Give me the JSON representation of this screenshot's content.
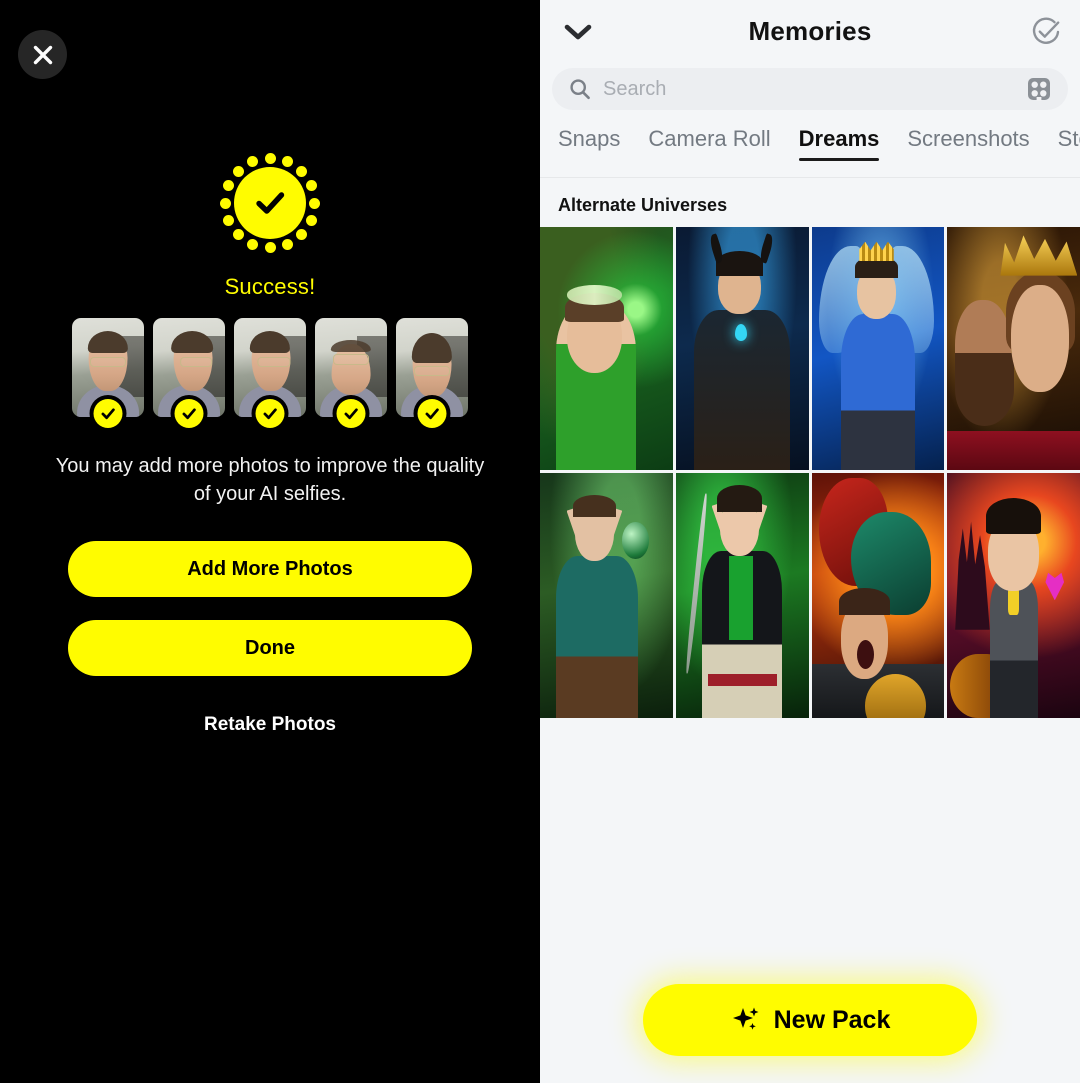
{
  "left": {
    "close_icon": "close-icon",
    "status_icon": "success-check-icon",
    "status_label": "Success!",
    "photos": [
      {
        "label": "selfie-front",
        "verified": true
      },
      {
        "label": "selfie-left-profile",
        "verified": true
      },
      {
        "label": "selfie-right-profile",
        "verified": true
      },
      {
        "label": "selfie-looking-up",
        "verified": true
      },
      {
        "label": "selfie-looking-down",
        "verified": true
      }
    ],
    "helper_text": "You may add more photos to improve the quality of your AI selfies.",
    "primary_button": "Add More Photos",
    "secondary_button": "Done",
    "text_button": "Retake Photos",
    "accent_color": "#FFFC00",
    "background_color": "#000000"
  },
  "right": {
    "header": {
      "collapse_icon": "chevron-down-icon",
      "title": "Memories",
      "select_icon": "circle-check-icon"
    },
    "search": {
      "icon": "search-icon",
      "placeholder": "Search",
      "value": "",
      "layout_icon": "grid-layout-icon"
    },
    "tabs": [
      {
        "label": "Snaps",
        "active": false
      },
      {
        "label": "Camera Roll",
        "active": false
      },
      {
        "label": "Dreams",
        "active": true
      },
      {
        "label": "Screenshots",
        "active": false
      },
      {
        "label": "Stories",
        "active": false
      }
    ],
    "section_title": "Alternate Universes",
    "gallery": [
      {
        "name": "green-forest-elf-king",
        "alt": "Smiling man in green shirt with leafy crown and star necklace"
      },
      {
        "name": "dark-horned-warrior",
        "alt": "Armored warrior with horns and glowing blue gem"
      },
      {
        "name": "blue-winged-fairy-king",
        "alt": "Man with translucent wings, gold crown and blue bodysuit"
      },
      {
        "name": "golden-crowned-kings",
        "alt": "Two bearded kings wearing golden crowns"
      },
      {
        "name": "forest-elf-with-orb",
        "alt": "Pointed-ear elf holding a green orb in mossy forest"
      },
      {
        "name": "green-elf-archer",
        "alt": "Elf archer with bow in bamboo forest"
      },
      {
        "name": "dragon-rider-shouting",
        "alt": "Shouting man in armor in front of red and green dragons"
      },
      {
        "name": "caricature-suit-dragon",
        "alt": "Caricature man in grey suit with yellow cravat and dragon"
      }
    ],
    "cta": {
      "icon": "sparkle-icon",
      "label": "New Pack"
    },
    "accent_color": "#FFFC00",
    "background_color": "#F4F6F8"
  }
}
